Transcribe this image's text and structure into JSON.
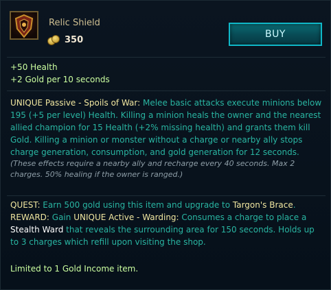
{
  "item": {
    "name": "Relic Shield",
    "price": "350",
    "icon": "relic-shield-icon",
    "buy_label": "BUY"
  },
  "stats": [
    "+50 Health",
    "+2 Gold per 10 seconds"
  ],
  "passive": {
    "title": "UNIQUE Passive - Spoils of War:",
    "text": " Melee basic attacks execute minions below 195 (+5 per level) Health. Killing a minion heals the owner and the nearest allied champion for 15 Health (+2% missing health) and grants them kill Gold. Killing a minion or monster without a charge or nearby ally stops charge generation, consumption, and gold generation for 12 seconds.",
    "note": "(These effects require a nearby ally and recharge every 40 seconds. Max 2 charges. 50% healing if the owner is ranged.)"
  },
  "quest": {
    "label": "QUEST:",
    "text": " Earn 500 gold using this item and upgrade to ",
    "target": "Targon's Brace",
    "end": "."
  },
  "reward": {
    "label": "REWARD:",
    "text1": " Gain ",
    "active": "UNIQUE Active - Warding:",
    "text2": " Consumes a charge to place a ",
    "ward": "Stealth Ward",
    "text3": " that reveals the surrounding area for 150 seconds. Holds up to 3 charges which refill upon visiting the shop."
  },
  "limit": "Limited to 1 Gold Income item.",
  "colors": {
    "accent_teal": "#29b5a2",
    "stat_green": "#cbffa0",
    "highlight_yellow": "#f0e6a0",
    "buy_border": "#0fb8c8"
  }
}
